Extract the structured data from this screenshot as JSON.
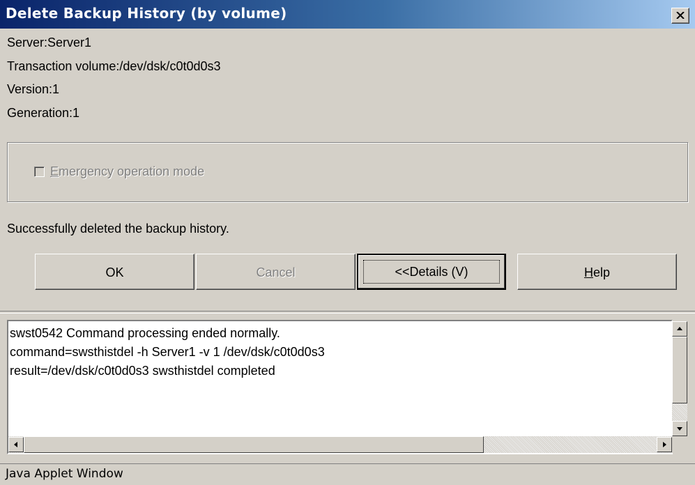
{
  "window": {
    "title": "Delete Backup History (by volume)"
  },
  "info": {
    "server": "Server:Server1",
    "transaction_volume": "Transaction volume:/dev/dsk/c0t0d0s3",
    "version": "Version:1",
    "generation": "Generation:1"
  },
  "options": {
    "emergency_label_key": "E",
    "emergency_label_rest": "mergency operation mode",
    "emergency_checked": false
  },
  "status_message": "Successfully deleted the backup history.",
  "buttons": {
    "ok": "OK",
    "cancel": "Cancel",
    "details": "<<Details  (V)",
    "help_key": "H",
    "help_rest": "elp"
  },
  "details": {
    "lines": [
      "swst0542 Command processing ended normally.",
      "command=swsthistdel -h Server1 -v 1 /dev/dsk/c0t0d0s3",
      "result=/dev/dsk/c0t0d0s3 swsthistdel completed"
    ]
  },
  "footer": "Java Applet Window",
  "colors": {
    "title_start": "#0a246a",
    "title_end": "#a6caf0",
    "face": "#d4d0c8"
  }
}
